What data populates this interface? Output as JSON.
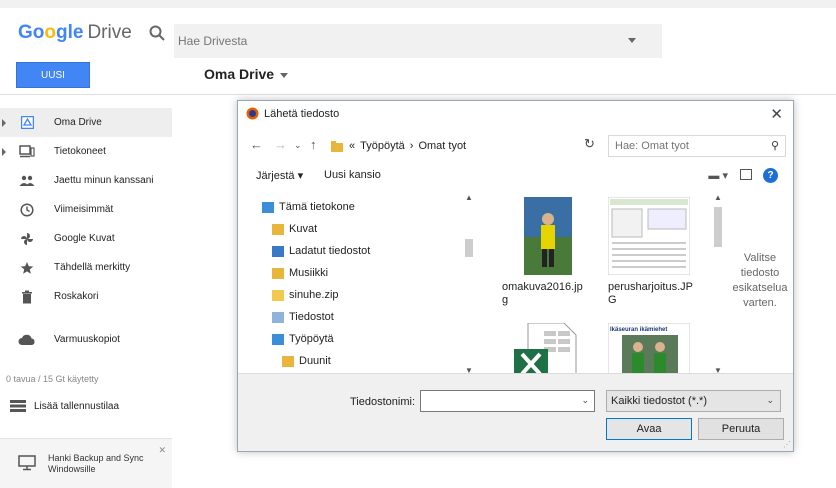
{
  "app": {
    "logo_g": "Go",
    "logo_o2": "o",
    "logo_gle": "gle",
    "logo_drive": "Drive",
    "search_placeholder": "Hae Drivesta",
    "new_button": "UUSI",
    "location_title": "Oma Drive"
  },
  "sidebar": {
    "items": [
      {
        "label": "Oma Drive",
        "icon": "drive-icon"
      },
      {
        "label": "Tietokoneet",
        "icon": "computer-icon"
      },
      {
        "label": "Jaettu minun kanssani",
        "icon": "people-icon"
      },
      {
        "label": "Viimeisimmät",
        "icon": "clock-icon"
      },
      {
        "label": "Google Kuvat",
        "icon": "pinwheel-icon"
      },
      {
        "label": "Tähdellä merkitty",
        "icon": "star-icon"
      },
      {
        "label": "Roskakori",
        "icon": "trash-icon"
      },
      {
        "label": "Varmuuskopiot",
        "icon": "cloud-icon"
      }
    ],
    "storage": "0 tavua / 15 Gt käytetty",
    "buy_storage": "Lisää tallennustilaa",
    "backup_line1": "Hanki Backup and Sync",
    "backup_line2": "Windowsille"
  },
  "dialog": {
    "title": "Lähetä tiedosto",
    "breadcrumb": [
      "«",
      "Työpöytä",
      "›",
      "Omat tyot"
    ],
    "search_placeholder": "Hae: Omat tyot",
    "organize": "Järjestä ▾",
    "new_folder": "Uusi kansio",
    "tree": [
      "Tämä tietokone",
      "Kuvat",
      "Ladatut tiedostot",
      "Musiikki",
      "sinuhe.zip",
      "Tiedostot",
      "Työpöytä",
      "Duunit"
    ],
    "files": [
      {
        "name_line1": "omakuva2016.jp",
        "name_line2": "g"
      },
      {
        "name_line1": "perusharjoitus.JP",
        "name_line2": "G"
      },
      {
        "name_line1": "",
        "name_line2": ""
      },
      {
        "name_line1": "",
        "name_line2": "",
        "thumb_text": "Ikäseuran ikämiehet"
      }
    ],
    "preview_text": "Valitse tiedosto esikatselua varten.",
    "filename_label": "Tiedostonimi:",
    "filename_value": "",
    "filetype": "Kaikki tiedostot (*.*)",
    "open_button": "Avaa",
    "cancel_button": "Peruuta"
  },
  "colors": {
    "accent": "#4285f4",
    "win_blue": "#0078d7",
    "folder": "#e8b63a"
  }
}
